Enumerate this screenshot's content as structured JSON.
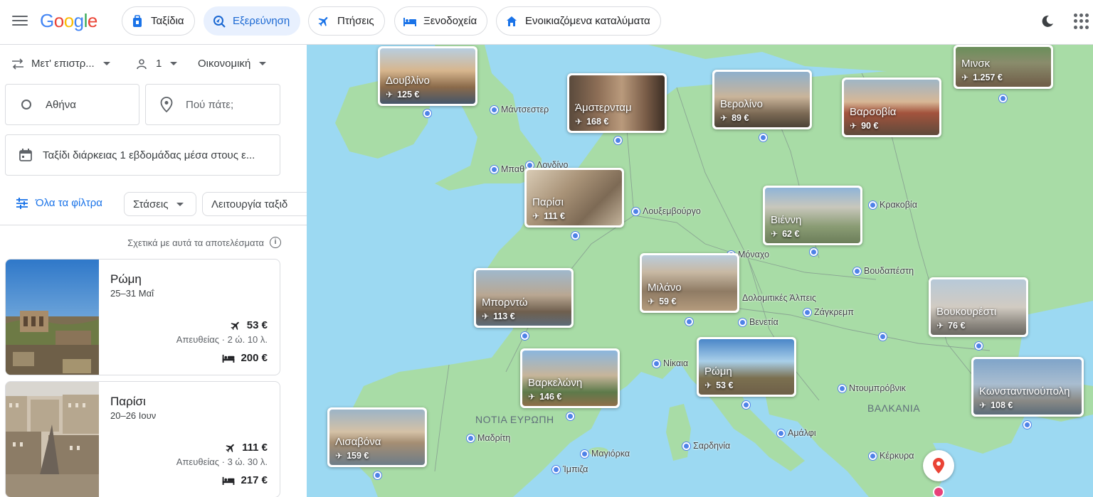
{
  "header": {
    "logo": "Google",
    "tabs": [
      {
        "label": "Ταξίδια",
        "icon": "luggage-icon"
      },
      {
        "label": "Εξερεύνηση",
        "icon": "explore-icon",
        "active": true
      },
      {
        "label": "Πτήσεις",
        "icon": "plane-icon"
      },
      {
        "label": "Ξενοδοχεία",
        "icon": "bed-icon"
      },
      {
        "label": "Ενοικιαζόμενα καταλύματα",
        "icon": "house-icon"
      }
    ]
  },
  "search": {
    "trip_type": "Μετ' επιστρ...",
    "passengers": "1",
    "cabin": "Οικονομική",
    "origin": "Αθήνα",
    "destination_placeholder": "Πού πάτε;",
    "dates": "Ταξίδι διάρκειας 1 εβδομάδας μέσα στους ε..."
  },
  "filters": {
    "all_filters": "Όλα τα φίλτρα",
    "stops": "Στάσεις",
    "mode": "Λειτουργία ταξιδ"
  },
  "results_note": "Σχετικά με αυτά τα αποτελέσματα",
  "results": [
    {
      "city": "Ρώμη",
      "dates": "25–31 Μαΐ",
      "flight_price": "53 €",
      "duration": "Απευθείας · 2 ώ. 10 λ.",
      "hotel_price": "200 €"
    },
    {
      "city": "Παρίσι",
      "dates": "20–26 Ιουν",
      "flight_price": "111 €",
      "duration": "Απευθείας · 3 ώ. 30 λ.",
      "hotel_price": "217 €"
    }
  ],
  "map": {
    "regions": [
      "ΝΟΤΙΑ ΕΥΡΩΠΗ",
      "ΒΑΛΚΑΝΙΑ"
    ],
    "labels": [
      "Μάντσεστερ",
      "Μπαθ",
      "Λονδίνο",
      "Λουξεμβούργο",
      "Κρακοβία",
      "Μόναχο",
      "Βουδαπέστη",
      "Δολομιτικές Άλπεις",
      "Ζάγκρεμπ",
      "Βενετία",
      "Νίκαια",
      "Ντουμπρόβνικ",
      "Αμάλφι",
      "Σαρδηνία",
      "Μαγιόρκα",
      "Ίμπιζα",
      "Μαδρίτη",
      "Κέρκυρα"
    ],
    "destinations": [
      {
        "name": "Δουβλίνο",
        "price": "125 €"
      },
      {
        "name": "Άμστερνταμ",
        "price": "168 €"
      },
      {
        "name": "Βερολίνο",
        "price": "89 €"
      },
      {
        "name": "Βαρσοβία",
        "price": "90 €"
      },
      {
        "name": "Μινσκ",
        "price": "1.257 €"
      },
      {
        "name": "Παρίσι",
        "price": "111 €"
      },
      {
        "name": "Βιέννη",
        "price": "62 €"
      },
      {
        "name": "Μιλάνο",
        "price": "59 €"
      },
      {
        "name": "Μπορντώ",
        "price": "113 €"
      },
      {
        "name": "Βουκουρέστι",
        "price": "76 €"
      },
      {
        "name": "Βαρκελώνη",
        "price": "146 €"
      },
      {
        "name": "Ρώμη",
        "price": "53 €"
      },
      {
        "name": "Κωνσταντινούπολη",
        "price": "108 €"
      },
      {
        "name": "Λισαβόνα",
        "price": "159 €"
      }
    ]
  }
}
